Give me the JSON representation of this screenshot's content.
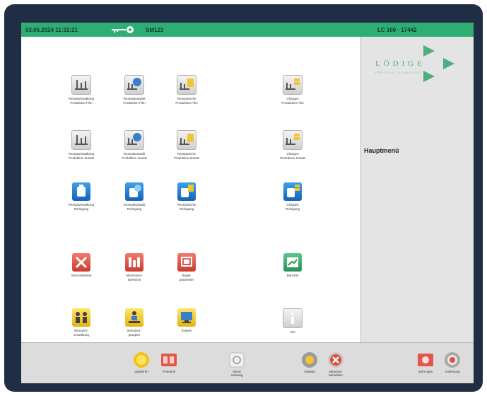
{
  "status": {
    "datetime": "03.06.2024  11:32:21",
    "user": "SM123",
    "station": "LC 100 - 17442"
  },
  "brand": {
    "logo_text": "LÖDIGE",
    "logo_sub": "PROCESS TECHNOLOGY"
  },
  "sidebar": {
    "title": "Hauptmenü"
  },
  "menu": [
    {
      "id": "rezeptverwaltung-produktion-film",
      "label": "Rezeptverwaltung\nProduktion Film",
      "icon": "recipe-management-icon"
    },
    {
      "id": "rezeptauswahl-produktion-film",
      "label": "Rezeptauswahl\nProduktion Film",
      "icon": "recipe-selection-icon"
    },
    {
      "id": "rezeptarchiv-produktion-film",
      "label": "Rezeptarchiv\nProduktion Film",
      "icon": "recipe-archive-icon"
    },
    {
      "id": "chargen-produktion-film",
      "label": "Chargen\nProduktion Film",
      "icon": "batch-icon"
    },
    {
      "id": "rezeptverwaltung-produktion-zusatz",
      "label": "Rezeptverwaltung\nProduktion Zusatz",
      "icon": "recipe-management-icon"
    },
    {
      "id": "rezeptauswahl-produktion-zusatz",
      "label": "Rezeptauswahl\nProduktion Zusatz",
      "icon": "recipe-selection-icon"
    },
    {
      "id": "rezeptarchiv-produktion-zusatz",
      "label": "Rezeptarchiv\nProduktion Zusatz",
      "icon": "recipe-archive-icon"
    },
    {
      "id": "chargen-produktion-zusatz",
      "label": "Chargen\nProduktion Zusatz",
      "icon": "batch-icon"
    },
    {
      "id": "rezeptverwaltung-reinigung",
      "label": "Rezeptverwaltung\nReinigung",
      "icon": "cleaning-recipe-icon"
    },
    {
      "id": "rezeptauswahl-reinigung",
      "label": "Rezeptauswahl\nReinigung",
      "icon": "cleaning-selection-icon"
    },
    {
      "id": "rezeptarchiv-reinigung",
      "label": "Rezeptarchiv\nReinigung",
      "icon": "cleaning-archive-icon"
    },
    {
      "id": "chargen-reinigung",
      "label": "Chargen\nReinigung",
      "icon": "cleaning-batch-icon"
    },
    {
      "id": "servicebetrieb",
      "label": "Servicebetrieb",
      "icon": "service-icon"
    },
    {
      "id": "maschinenuebersicht",
      "label": "Maschinen-\nübersicht",
      "icon": "machine-overview-icon"
    },
    {
      "id": "regelparameter",
      "label": "Regel-\nparameter",
      "icon": "control-parameters-icon"
    },
    {
      "id": "berichte",
      "label": "Berichte",
      "icon": "reports-icon"
    },
    {
      "id": "benutzerverwaltung",
      "label": "Benutzer-\nverwaltung",
      "icon": "user-management-icon"
    },
    {
      "id": "benutzergruppen",
      "label": "Benutzer-\ngruppen",
      "icon": "user-groups-icon"
    },
    {
      "id": "system",
      "label": "System",
      "icon": "system-icon"
    },
    {
      "id": "info",
      "label": "Info",
      "icon": "info-icon"
    }
  ],
  "bottom": [
    {
      "id": "quittieren",
      "label": "Quittieren",
      "icon": "acknowledge-icon"
    },
    {
      "id": "protokoll",
      "label": "Protokoll",
      "icon": "log-icon"
    },
    {
      "id": "menue-rueckweg",
      "label": "Menü\nrückweg",
      "icon": "menu-back-icon"
    },
    {
      "id": "tastatur",
      "label": "Tastatur",
      "icon": "keyboard-icon"
    },
    {
      "id": "abmelden",
      "label": "Benutzer\nabmelden",
      "icon": "logout-icon"
    },
    {
      "id": "stoerungen",
      "label": "Störungen",
      "icon": "alarms-icon"
    },
    {
      "id": "ausloesung",
      "label": "Auslösung",
      "icon": "trigger-icon"
    }
  ]
}
